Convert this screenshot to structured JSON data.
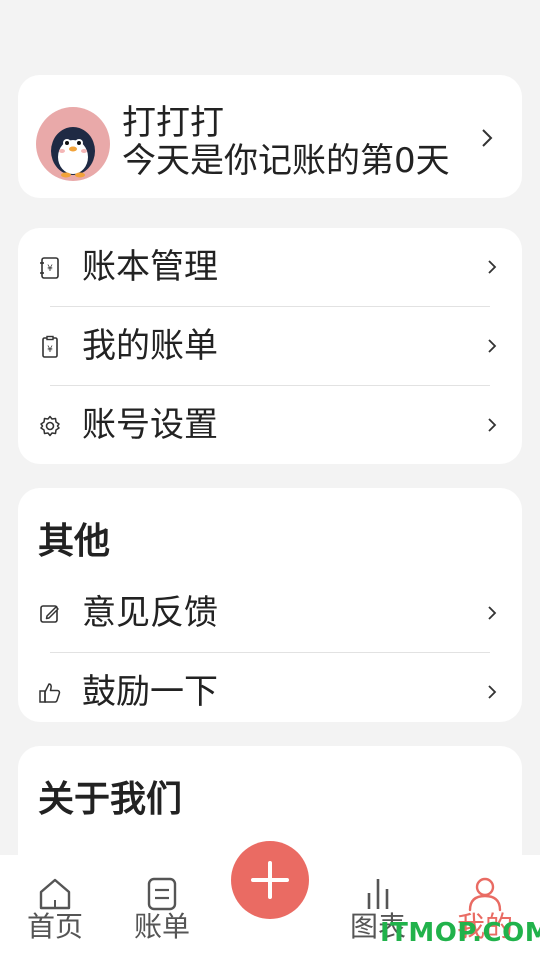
{
  "profile": {
    "name": "打打打",
    "subtitle": "今天是你记账的第0天",
    "avatar_icon": "penguin-avatar"
  },
  "menu": [
    {
      "label": "账本管理",
      "icon": "ledger-icon"
    },
    {
      "label": "我的账单",
      "icon": "bill-icon"
    },
    {
      "label": "账号设置",
      "icon": "gear-icon"
    }
  ],
  "other": {
    "title": "其他",
    "items": [
      {
        "label": "意见反馈",
        "icon": "edit-icon"
      },
      {
        "label": "鼓励一下",
        "icon": "thumbs-up-icon"
      }
    ]
  },
  "about": {
    "title": "关于我们"
  },
  "tabbar": {
    "items": [
      {
        "label": "首页",
        "icon": "home-icon"
      },
      {
        "label": "账单",
        "icon": "list-icon"
      },
      {
        "label": "图表",
        "icon": "chart-icon"
      },
      {
        "label": "我的",
        "icon": "user-icon"
      }
    ],
    "active_index": 3
  },
  "fab": {
    "icon": "plus-icon",
    "color": "#ea6b63"
  },
  "colors": {
    "accent": "#e96b63",
    "background": "#f3f3f3"
  },
  "watermark": "ITMOP.COM"
}
